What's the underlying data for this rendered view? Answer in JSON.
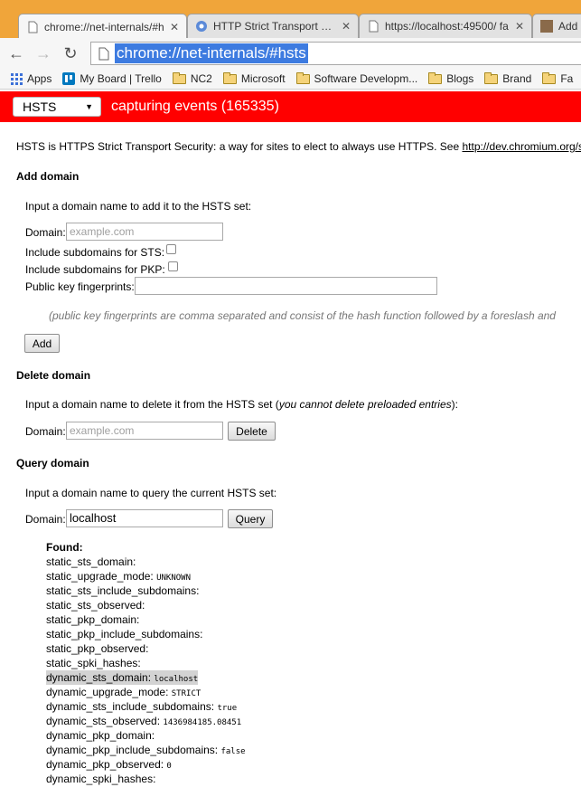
{
  "tabs": [
    {
      "title": "chrome://net-internals/#h",
      "active": true
    },
    {
      "title": "HTTP Strict Transport Secu",
      "active": false
    },
    {
      "title": "https://localhost:49500/ fa",
      "active": false
    },
    {
      "title": "Add",
      "active": false
    }
  ],
  "toolbar": {
    "url": "chrome://net-internals/#hsts"
  },
  "bookmarks": [
    "Apps",
    "My Board | Trello",
    "NC2",
    "Microsoft",
    "Software Developm...",
    "Blogs",
    "Brand",
    "Fa"
  ],
  "header": {
    "view_select": "HSTS",
    "status": "capturing events (165335)"
  },
  "intro": {
    "text": "HSTS is HTTPS Strict Transport Security: a way for sites to elect to always use HTTPS. See ",
    "link": "http://dev.chromium.org/sts",
    "suffix": "."
  },
  "add": {
    "heading": "Add domain",
    "instruction": "Input a domain name to add it to the HSTS set:",
    "domain_label": "Domain:",
    "domain_placeholder": "example.com",
    "sts_label": "Include subdomains for STS:",
    "pkp_label": "Include subdomains for PKP:",
    "fingerprints_label": "Public key fingerprints:",
    "note": "(public key fingerprints are comma separated and consist of the hash function followed by a foreslash and",
    "button": "Add"
  },
  "delete": {
    "heading": "Delete domain",
    "instruction_a": "Input a domain name to delete it from the HSTS set (",
    "instruction_em": "you cannot delete preloaded entries",
    "instruction_b": "):",
    "domain_label": "Domain:",
    "domain_placeholder": "example.com",
    "button": "Delete"
  },
  "query": {
    "heading": "Query domain",
    "instruction": "Input a domain name to query the current HSTS set:",
    "domain_label": "Domain:",
    "domain_value": "localhost",
    "button": "Query",
    "found": "Found:",
    "rows": [
      {
        "key": "static_sts_domain:",
        "value": ""
      },
      {
        "key": "static_upgrade_mode:",
        "value": "UNKNOWN"
      },
      {
        "key": "static_sts_include_subdomains:",
        "value": ""
      },
      {
        "key": "static_sts_observed:",
        "value": ""
      },
      {
        "key": "static_pkp_domain:",
        "value": ""
      },
      {
        "key": "static_pkp_include_subdomains:",
        "value": ""
      },
      {
        "key": "static_pkp_observed:",
        "value": ""
      },
      {
        "key": "static_spki_hashes:",
        "value": ""
      },
      {
        "key": "dynamic_sts_domain:",
        "value": "localhost"
      },
      {
        "key": "dynamic_upgrade_mode:",
        "value": "STRICT"
      },
      {
        "key": "dynamic_sts_include_subdomains:",
        "value": "true"
      },
      {
        "key": "dynamic_sts_observed:",
        "value": "1436984185.08451"
      },
      {
        "key": "dynamic_pkp_domain:",
        "value": ""
      },
      {
        "key": "dynamic_pkp_include_subdomains:",
        "value": "false"
      },
      {
        "key": "dynamic_pkp_observed:",
        "value": "0"
      },
      {
        "key": "dynamic_spki_hashes:",
        "value": ""
      }
    ]
  },
  "colors": {
    "header_bg": "#ff0000",
    "tabstrip_bg": "#f0a53a",
    "url_highlight": "#3d7be0"
  }
}
